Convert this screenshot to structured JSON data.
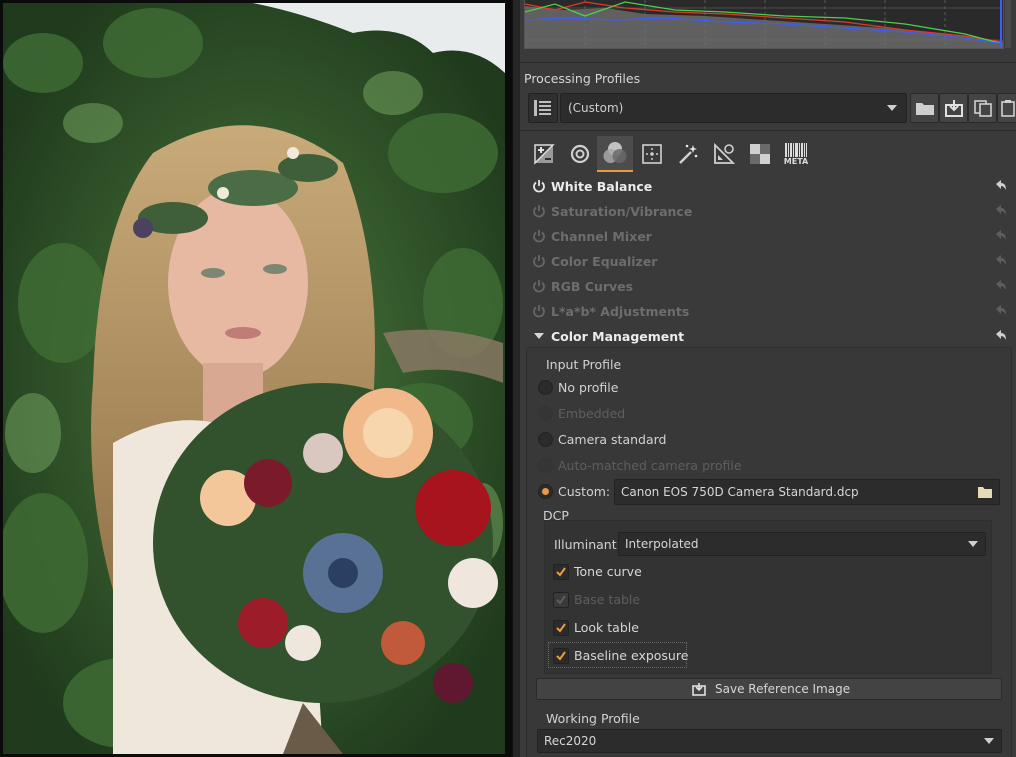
{
  "histogram": {
    "colors": {
      "red": "#e0392b",
      "green": "#4bd14b",
      "blue": "#3c5cff",
      "luma": "#9a9a9a"
    }
  },
  "processing_profiles": {
    "label": "Processing Profiles",
    "selected": "(Custom)",
    "icons": [
      "profile-list-icon",
      "open-folder-icon",
      "save-profile-icon",
      "copy-profile-icon",
      "paste-profile-icon"
    ]
  },
  "tabs": {
    "items": [
      "exposure-tab-icon",
      "detail-tab-icon",
      "color-tab-icon",
      "transform-tab-icon",
      "raw-tab-icon",
      "lens-tab-icon",
      "locallab-tab-icon"
    ],
    "meta_label": "META",
    "accent": "#e89b45"
  },
  "tools": [
    {
      "label": "White Balance",
      "enabled": true
    },
    {
      "label": "Saturation/Vibrance",
      "enabled": false
    },
    {
      "label": "Channel Mixer",
      "enabled": false
    },
    {
      "label": "Color Equalizer",
      "enabled": false
    },
    {
      "label": "RGB Curves",
      "enabled": false
    },
    {
      "label": "L*a*b* Adjustments",
      "enabled": false
    },
    {
      "label": "Color Management",
      "enabled": true,
      "expanded": true
    }
  ],
  "color_management": {
    "input_profile": {
      "title": "Input Profile",
      "options": [
        {
          "label": "No profile",
          "enabled": true,
          "selected": false
        },
        {
          "label": "Embedded",
          "enabled": false,
          "selected": false
        },
        {
          "label": "Camera standard",
          "enabled": true,
          "selected": false
        },
        {
          "label": "Auto-matched camera profile",
          "enabled": false,
          "selected": false
        },
        {
          "label": "Custom:",
          "enabled": true,
          "selected": true
        }
      ],
      "custom_file": "Canon EOS 750D Camera Standard.dcp"
    },
    "dcp": {
      "title": "DCP",
      "illuminant_label": "Illuminant:",
      "illuminant_value": "Interpolated",
      "checkboxes": [
        {
          "label": "Tone curve",
          "checked": true,
          "enabled": true
        },
        {
          "label": "Base table",
          "checked": true,
          "enabled": false
        },
        {
          "label": "Look table",
          "checked": true,
          "enabled": true
        },
        {
          "label": "Baseline exposure",
          "checked": true,
          "enabled": true
        }
      ]
    },
    "save_reference": "Save Reference Image",
    "working_profile": {
      "title": "Working Profile",
      "value": "Rec2020"
    }
  }
}
